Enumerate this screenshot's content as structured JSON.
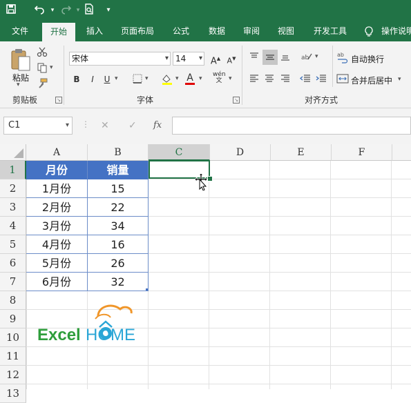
{
  "quick_access": {
    "save_icon": "save-icon",
    "undo_icon": "undo-icon",
    "redo_icon": "redo-icon",
    "preview_icon": "print-preview-icon",
    "customize_icon": "customize-toolbar-icon"
  },
  "tabs": [
    {
      "label": "文件"
    },
    {
      "label": "开始",
      "active": true
    },
    {
      "label": "插入"
    },
    {
      "label": "页面布局"
    },
    {
      "label": "公式"
    },
    {
      "label": "数据"
    },
    {
      "label": "审阅"
    },
    {
      "label": "视图"
    },
    {
      "label": "开发工具"
    },
    {
      "label": "操作说明"
    }
  ],
  "ribbon": {
    "clipboard": {
      "paste_label": "粘贴",
      "group_label": "剪贴板"
    },
    "font": {
      "font_name": "宋体",
      "font_size": "14",
      "group_label": "字体",
      "bold": "B",
      "italic": "I",
      "underline": "U",
      "phonetic": "wén"
    },
    "alignment": {
      "wrap_text": "自动换行",
      "merge_center": "合并后居中",
      "group_label": "对齐方式"
    }
  },
  "formula_bar": {
    "name_box": "C1",
    "fx_label": "fx",
    "formula": ""
  },
  "columns": [
    "A",
    "B",
    "C",
    "D",
    "E",
    "F"
  ],
  "selected_column": "C",
  "rows": [
    "1",
    "2",
    "3",
    "4",
    "5",
    "6",
    "7",
    "8",
    "9",
    "10",
    "11",
    "12",
    "13"
  ],
  "selected_row": "1",
  "table": {
    "headers": [
      "月份",
      "销量"
    ],
    "rows": [
      [
        "1月份",
        "15"
      ],
      [
        "2月份",
        "22"
      ],
      [
        "3月份",
        "34"
      ],
      [
        "4月份",
        "16"
      ],
      [
        "5月份",
        "26"
      ],
      [
        "6月份",
        "32"
      ]
    ]
  },
  "colors": {
    "accent": "#217346",
    "table_header": "#4472c4",
    "table_border": "#6b8cc8"
  },
  "logo": {
    "text_excel": "Excel",
    "text_home": "HOME"
  }
}
